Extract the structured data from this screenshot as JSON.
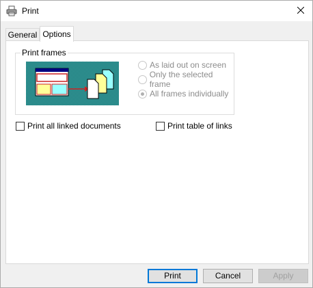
{
  "window": {
    "title": "Print"
  },
  "tabs": [
    {
      "label": "General",
      "selected": false
    },
    {
      "label": "Options",
      "selected": true
    }
  ],
  "print_frames": {
    "group_label": "Print frames",
    "options": [
      {
        "label": "As laid out on screen",
        "checked": false,
        "enabled": false
      },
      {
        "label": "Only the selected frame",
        "checked": false,
        "enabled": false
      },
      {
        "label": "All frames individually",
        "checked": true,
        "enabled": false
      }
    ]
  },
  "checkboxes": {
    "print_linked": {
      "label": "Print all linked documents",
      "checked": false
    },
    "print_table": {
      "label": "Print table of links",
      "checked": false
    }
  },
  "buttons": {
    "print": "Print",
    "cancel": "Cancel",
    "apply": "Apply"
  },
  "colors": {
    "illustration_bg": "#2f9e9e",
    "frame_red": "#cc2222",
    "frame_yellow": "#ffff99",
    "frame_cyan": "#99ffff",
    "accent": "#0078d7"
  }
}
